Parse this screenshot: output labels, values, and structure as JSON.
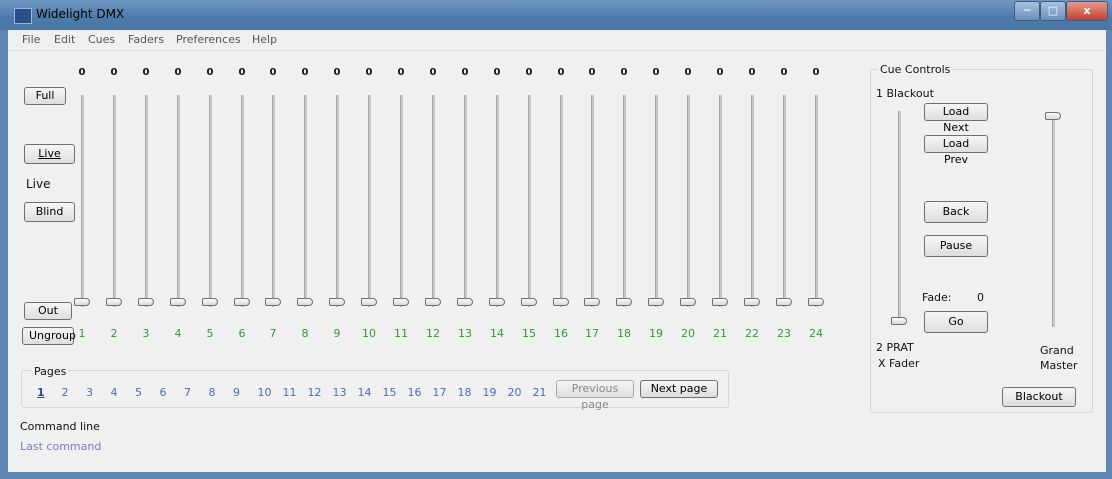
{
  "window": {
    "title": "Widelight DMX",
    "minimize_icon": "minimize-icon",
    "maximize_icon": "maximize-icon",
    "close_glyph": "x"
  },
  "menu": [
    "File",
    "Edit",
    "Cues",
    "Faders",
    "Preferences",
    "Help"
  ],
  "left_controls": {
    "full_label": "Full",
    "live_label": "Live",
    "mode_status": "Live",
    "blind_label": "Blind",
    "out_label": "Out",
    "ungroup_label": "Ungroup"
  },
  "channels": [
    {
      "num": "1",
      "value": "0"
    },
    {
      "num": "2",
      "value": "0"
    },
    {
      "num": "3",
      "value": "0"
    },
    {
      "num": "4",
      "value": "0"
    },
    {
      "num": "5",
      "value": "0"
    },
    {
      "num": "6",
      "value": "0"
    },
    {
      "num": "7",
      "value": "0"
    },
    {
      "num": "8",
      "value": "0"
    },
    {
      "num": "9",
      "value": "0"
    },
    {
      "num": "10",
      "value": "0"
    },
    {
      "num": "11",
      "value": "0"
    },
    {
      "num": "12",
      "value": "0"
    },
    {
      "num": "13",
      "value": "0"
    },
    {
      "num": "14",
      "value": "0"
    },
    {
      "num": "15",
      "value": "0"
    },
    {
      "num": "16",
      "value": "0"
    },
    {
      "num": "17",
      "value": "0"
    },
    {
      "num": "18",
      "value": "0"
    },
    {
      "num": "19",
      "value": "0"
    },
    {
      "num": "20",
      "value": "0"
    },
    {
      "num": "21",
      "value": "0"
    },
    {
      "num": "22",
      "value": "0"
    },
    {
      "num": "23",
      "value": "0"
    },
    {
      "num": "24",
      "value": "0"
    }
  ],
  "pages": {
    "title": "Pages",
    "items": [
      "1",
      "2",
      "3",
      "4",
      "5",
      "6",
      "7",
      "8",
      "9",
      "10",
      "11",
      "12",
      "13",
      "14",
      "15",
      "16",
      "17",
      "18",
      "19",
      "20",
      "21"
    ],
    "current": "1",
    "previous_label": "Previous page",
    "next_label": "Next page"
  },
  "cue_controls": {
    "title": "Cue Controls",
    "current_cue": "1 Blackout",
    "next_cue": "2 PRAT",
    "xfader_label": "X Fader",
    "load_next_label": "Load Next",
    "load_prev_label": "Load Prev",
    "back_label": "Back",
    "pause_label": "Pause",
    "fade_label": "Fade:",
    "fade_value": "0",
    "go_label": "Go",
    "grand_master_line1": "Grand",
    "grand_master_line2": "Master",
    "blackout_label": "Blackout"
  },
  "command": {
    "label": "Command line",
    "last_command": "Last command"
  },
  "colors": {
    "title_bar": "#5a85b5",
    "channel_number": "#2c9e2c",
    "link": "#4a6fb0"
  }
}
